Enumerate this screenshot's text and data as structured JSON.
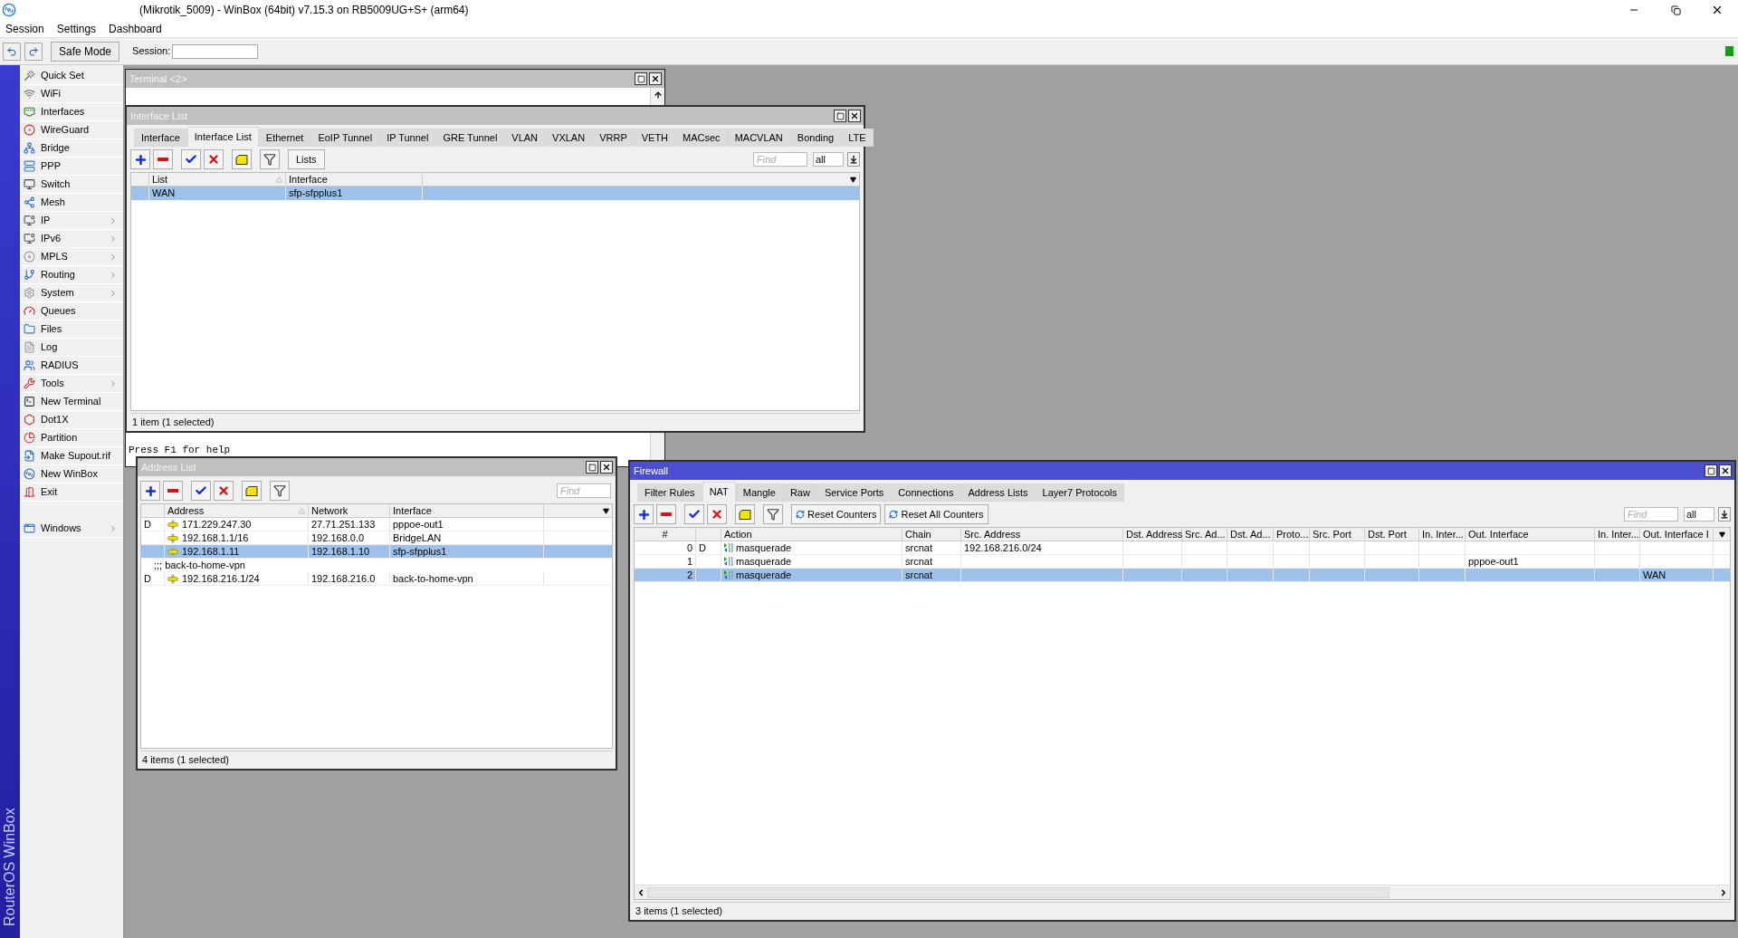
{
  "title_bar": {
    "title": "(Mikrotik_5009) - WinBox (64bit) v7.15.3 on RB5009UG+S+ (arm64)"
  },
  "menu_bar": [
    "Session",
    "Settings",
    "Dashboard"
  ],
  "toolbar": {
    "safe_mode": "Safe Mode",
    "session_label": "Session:"
  },
  "sidebar": {
    "brand": "RouterOS WinBox",
    "items": [
      {
        "label": "Quick Set",
        "submenu": false
      },
      {
        "label": "WiFi",
        "submenu": false
      },
      {
        "label": "Interfaces",
        "submenu": false
      },
      {
        "label": "WireGuard",
        "submenu": false
      },
      {
        "label": "Bridge",
        "submenu": false
      },
      {
        "label": "PPP",
        "submenu": false
      },
      {
        "label": "Switch",
        "submenu": false
      },
      {
        "label": "Mesh",
        "submenu": false
      },
      {
        "label": "IP",
        "submenu": true
      },
      {
        "label": "IPv6",
        "submenu": true
      },
      {
        "label": "MPLS",
        "submenu": true
      },
      {
        "label": "Routing",
        "submenu": true
      },
      {
        "label": "System",
        "submenu": true
      },
      {
        "label": "Queues",
        "submenu": false
      },
      {
        "label": "Files",
        "submenu": false
      },
      {
        "label": "Log",
        "submenu": false
      },
      {
        "label": "RADIUS",
        "submenu": false
      },
      {
        "label": "Tools",
        "submenu": true
      },
      {
        "label": "New Terminal",
        "submenu": false
      },
      {
        "label": "Dot1X",
        "submenu": false
      },
      {
        "label": "Partition",
        "submenu": false
      },
      {
        "label": "Make Supout.rif",
        "submenu": false
      },
      {
        "label": "New WinBox",
        "submenu": false
      },
      {
        "label": "Exit",
        "submenu": false
      }
    ],
    "bottom_item": {
      "label": "Windows",
      "submenu": true
    }
  },
  "terminal_window": {
    "title": "Terminal <2>",
    "active": false,
    "line": "Press F1 for help"
  },
  "interface_list_window": {
    "title": "Interface List",
    "active": false,
    "tabs": [
      {
        "label": "Interface",
        "selected": false
      },
      {
        "label": "Interface List",
        "selected": true
      },
      {
        "label": "Ethernet",
        "selected": false
      },
      {
        "label": "EoIP Tunnel",
        "selected": false
      },
      {
        "label": "IP Tunnel",
        "selected": false
      },
      {
        "label": "GRE Tunnel",
        "selected": false
      },
      {
        "label": "VLAN",
        "selected": false
      },
      {
        "label": "VXLAN",
        "selected": false
      },
      {
        "label": "VRRP",
        "selected": false
      },
      {
        "label": "VETH",
        "selected": false
      },
      {
        "label": "MACsec",
        "selected": false
      },
      {
        "label": "MACVLAN",
        "selected": false
      },
      {
        "label": "Bonding",
        "selected": false
      },
      {
        "label": "LTE",
        "selected": false
      }
    ],
    "lists_button": "Lists",
    "find_placeholder": "Find",
    "filter_value": "all",
    "columns": [
      "List",
      "Interface"
    ],
    "rows": [
      {
        "list": "WAN",
        "interface": "sfp-sfpplus1",
        "selected": true
      }
    ],
    "status": "1 item (1 selected)"
  },
  "address_list_window": {
    "title": "Address List",
    "active": false,
    "find_placeholder": "Find",
    "columns": [
      "Address",
      "Network",
      "Interface"
    ],
    "rows": [
      {
        "kind": "address",
        "flag": "D",
        "address": "171.229.247.30",
        "network": "27.71.251.133",
        "interface": "pppoe-out1",
        "selected": false
      },
      {
        "kind": "address",
        "address": "192.168.1.1/16",
        "network": "192.168.0.0",
        "interface": "BridgeLAN",
        "selected": false
      },
      {
        "kind": "address",
        "address": "192.168.1.11",
        "network": "192.168.1.10",
        "interface": "sfp-sfpplus1",
        "selected": true
      },
      {
        "kind": "comment",
        "text": ";;; back-to-home-vpn",
        "selected": false
      },
      {
        "kind": "address",
        "flag": "D",
        "address": "192.168.216.1/24",
        "network": "192.168.216.0",
        "interface": "back-to-home-vpn",
        "selected": false
      }
    ],
    "status": "4 items (1 selected)"
  },
  "firewall_window": {
    "title": "Firewall",
    "active": true,
    "tabs": [
      {
        "label": "Filter Rules",
        "selected": false
      },
      {
        "label": "NAT",
        "selected": true
      },
      {
        "label": "Mangle",
        "selected": false
      },
      {
        "label": "Raw",
        "selected": false
      },
      {
        "label": "Service Ports",
        "selected": false
      },
      {
        "label": "Connections",
        "selected": false
      },
      {
        "label": "Address Lists",
        "selected": false
      },
      {
        "label": "Layer7 Protocols",
        "selected": false
      }
    ],
    "reset_counters": "Reset Counters",
    "reset_all_counters": "Reset All Counters",
    "find_placeholder": "Find",
    "filter_value": "all",
    "columns": [
      "#",
      "Action",
      "Chain",
      "Src. Address",
      "Dst. Address",
      "Src. Ad...",
      "Dst. Ad...",
      "Proto...",
      "Src. Port",
      "Dst. Port",
      "In. Inter...",
      "Out. Interface",
      "In. Inter...",
      "Out. Interface I"
    ],
    "rows": [
      {
        "number": "0",
        "flag": "D",
        "action": "masquerade",
        "chain": "srcnat",
        "src_address": "192.168.216.0/24",
        "selected": false
      },
      {
        "number": "1",
        "action": "masquerade",
        "chain": "srcnat",
        "out_interface": "pppoe-out1",
        "selected": false
      },
      {
        "number": "2",
        "action": "masquerade",
        "chain": "srcnat",
        "out_interface_list": "WAN",
        "selected": true
      }
    ],
    "status": "3 items (1 selected)"
  }
}
